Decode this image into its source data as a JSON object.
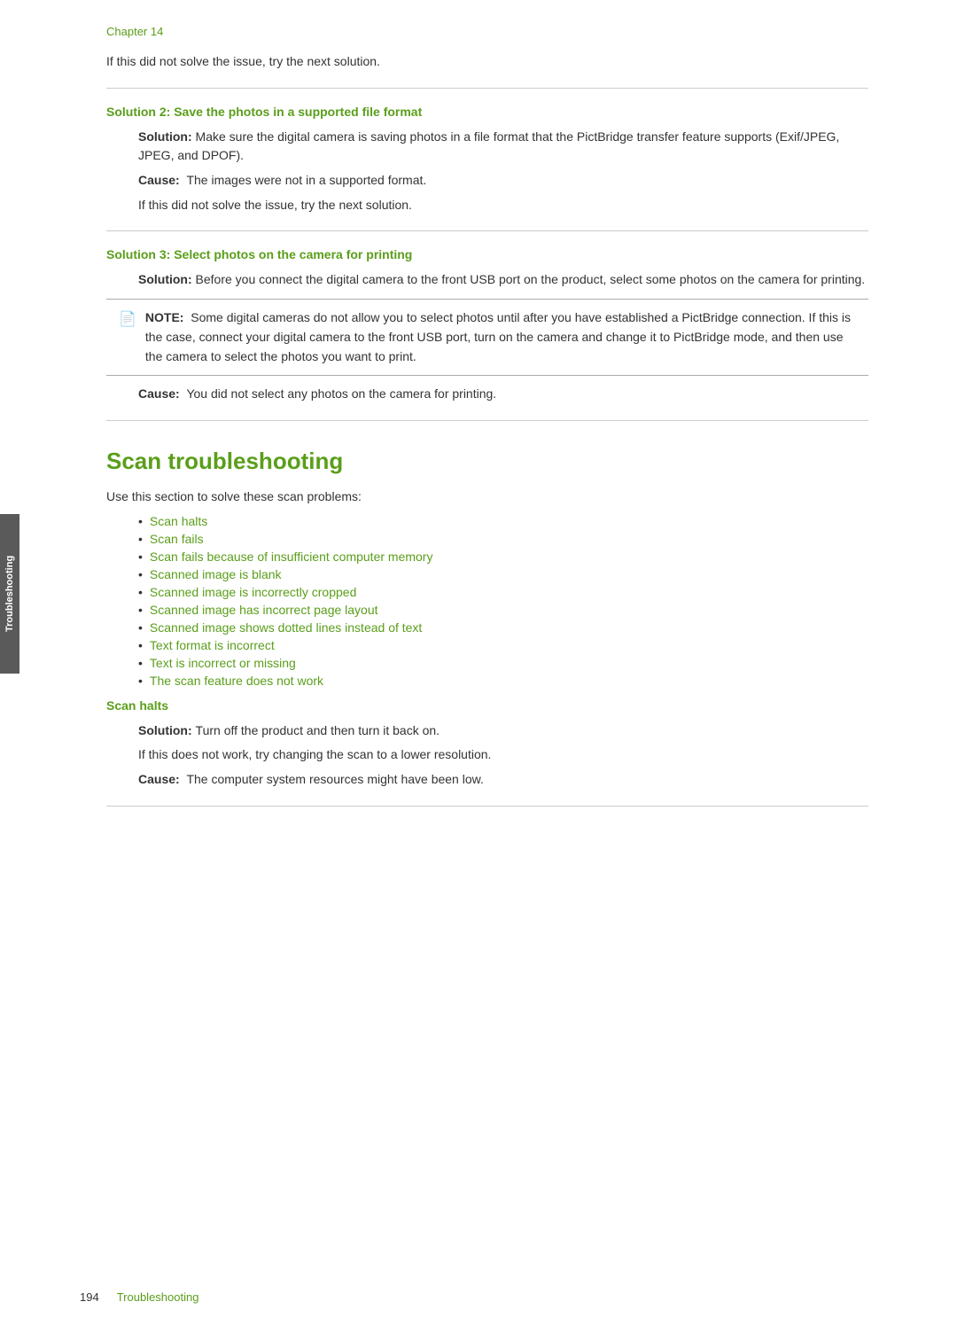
{
  "chapter": {
    "label": "Chapter 14"
  },
  "solution2": {
    "heading": "Solution 2: Save the photos in a supported file format",
    "solution_label": "Solution:",
    "solution_text": "Make sure the digital camera is saving photos in a file format that the PictBridge transfer feature supports (Exif/JPEG, JPEG, and DPOF).",
    "cause_label": "Cause:",
    "cause_text": "The images were not in a supported format.",
    "followup": "If this did not solve the issue, try the next solution."
  },
  "solution3": {
    "heading": "Solution 3: Select photos on the camera for printing",
    "solution_label": "Solution:",
    "solution_text": "Before you connect the digital camera to the front USB port on the product, select some photos on the camera for printing.",
    "note_label": "NOTE:",
    "note_text": "Some digital cameras do not allow you to select photos until after you have established a PictBridge connection. If this is the case, connect your digital camera to the front USB port, turn on the camera and change it to PictBridge mode, and then use the camera to select the photos you want to print.",
    "cause_label": "Cause:",
    "cause_text": "You did not select any photos on the camera for printing."
  },
  "intro": {
    "text_before": "If this did not solve the issue, try the next solution."
  },
  "scan_troubleshooting": {
    "heading": "Scan troubleshooting",
    "intro": "Use this section to solve these scan problems:",
    "links": [
      "Scan halts",
      "Scan fails",
      "Scan fails because of insufficient computer memory",
      "Scanned image is blank",
      "Scanned image is incorrectly cropped",
      "Scanned image has incorrect page layout",
      "Scanned image shows dotted lines instead of text",
      "Text format is incorrect",
      "Text is incorrect or missing",
      "The scan feature does not work"
    ]
  },
  "scan_halts": {
    "heading": "Scan halts",
    "solution_label": "Solution:",
    "solution_text": "Turn off the product and then turn it back on.",
    "followup": "If this does not work, try changing the scan to a lower resolution.",
    "cause_label": "Cause:",
    "cause_text": "The computer system resources might have been low."
  },
  "footer": {
    "page_number": "194",
    "label": "Troubleshooting"
  },
  "side_tab": {
    "label": "Troubleshooting"
  }
}
